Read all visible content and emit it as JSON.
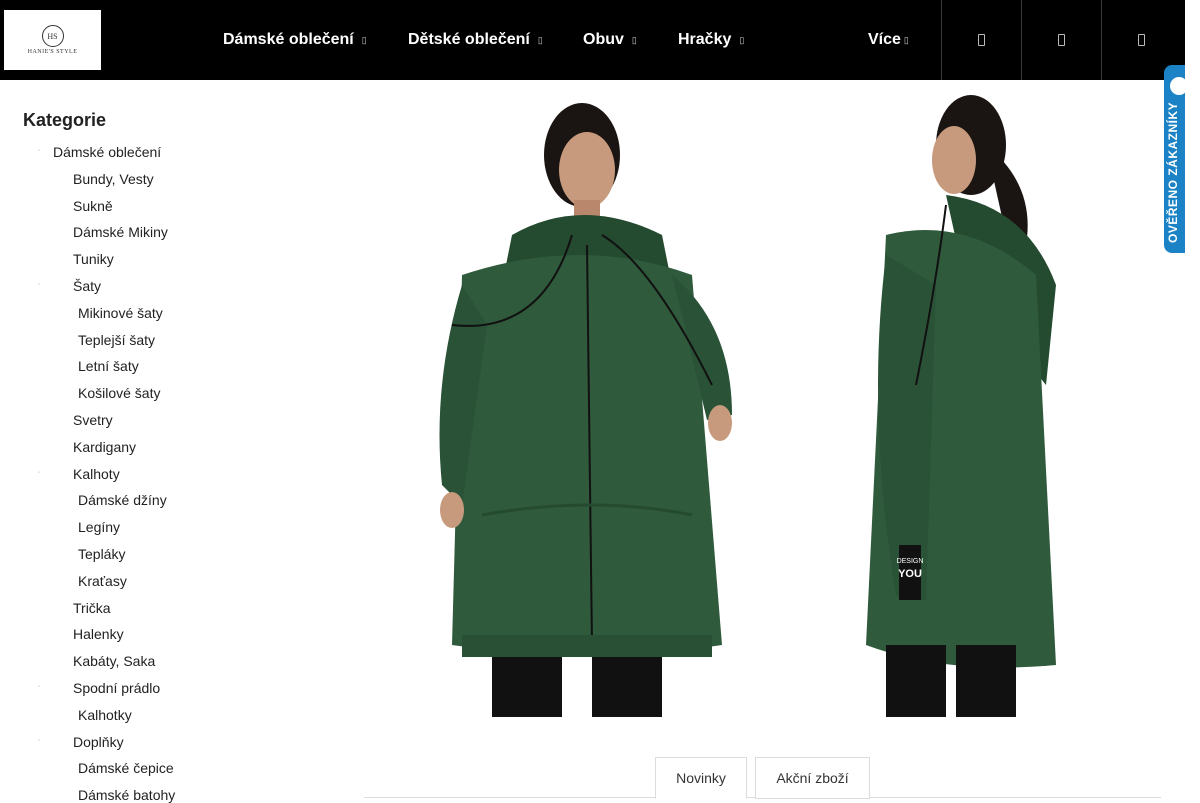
{
  "header": {
    "logo": {
      "initials": "HS",
      "name": "HANIE'S STYLE",
      "tagline": ""
    },
    "nav": [
      {
        "label": "Dámské oblečení"
      },
      {
        "label": "Dětské oblečení"
      },
      {
        "label": "Obuv"
      },
      {
        "label": "Hračky"
      },
      {
        "label": "Více"
      }
    ],
    "buttons": [
      "search-icon",
      "user-icon",
      "cart-icon"
    ]
  },
  "sidebar": {
    "title": "Kategorie",
    "items": [
      {
        "label": "Dámské oblečení",
        "level": 0,
        "has_bullet": true
      },
      {
        "label": "Bundy, Vesty",
        "level": 1
      },
      {
        "label": "Sukně",
        "level": 1
      },
      {
        "label": "Dámské Mikiny",
        "level": 1
      },
      {
        "label": "Tuniky",
        "level": 1
      },
      {
        "label": "Šaty",
        "level": 1,
        "has_bullet": true
      },
      {
        "label": "Mikinové šaty",
        "level": 2
      },
      {
        "label": "Teplejší šaty",
        "level": 2
      },
      {
        "label": "Letní šaty",
        "level": 2
      },
      {
        "label": "Košilové šaty",
        "level": 2
      },
      {
        "label": "Svetry",
        "level": 1
      },
      {
        "label": "Kardigany",
        "level": 1
      },
      {
        "label": "Kalhoty",
        "level": 1,
        "has_bullet": true
      },
      {
        "label": "Dámské džíny",
        "level": 2
      },
      {
        "label": "Legíny",
        "level": 2
      },
      {
        "label": "Tepláky",
        "level": 2
      },
      {
        "label": "Kraťasy",
        "level": 2
      },
      {
        "label": "Trička",
        "level": 1
      },
      {
        "label": "Halenky",
        "level": 1
      },
      {
        "label": "Kabáty, Saka",
        "level": 1
      },
      {
        "label": "Spodní prádlo",
        "level": 1,
        "has_bullet": true
      },
      {
        "label": "Kalhotky",
        "level": 2
      },
      {
        "label": "Doplňky",
        "level": 1,
        "has_bullet": true
      },
      {
        "label": "Dámské čepice",
        "level": 2
      },
      {
        "label": "Dámské batohy",
        "level": 2
      }
    ]
  },
  "product": {
    "sleeve_print": "DESIGN YOU",
    "colors": {
      "garment": "#2f5a3c",
      "garment_dark": "#244a30",
      "pants": "#111111",
      "skin": "#c79a7e",
      "hair": "#1a1412"
    }
  },
  "badge": {
    "text": "OVĚŘENO ZÁKAZNÍKY",
    "color": "#1b82c5"
  },
  "tabs": [
    {
      "label": "Novinky",
      "active": true
    },
    {
      "label": "Akční zboží",
      "active": false
    }
  ]
}
